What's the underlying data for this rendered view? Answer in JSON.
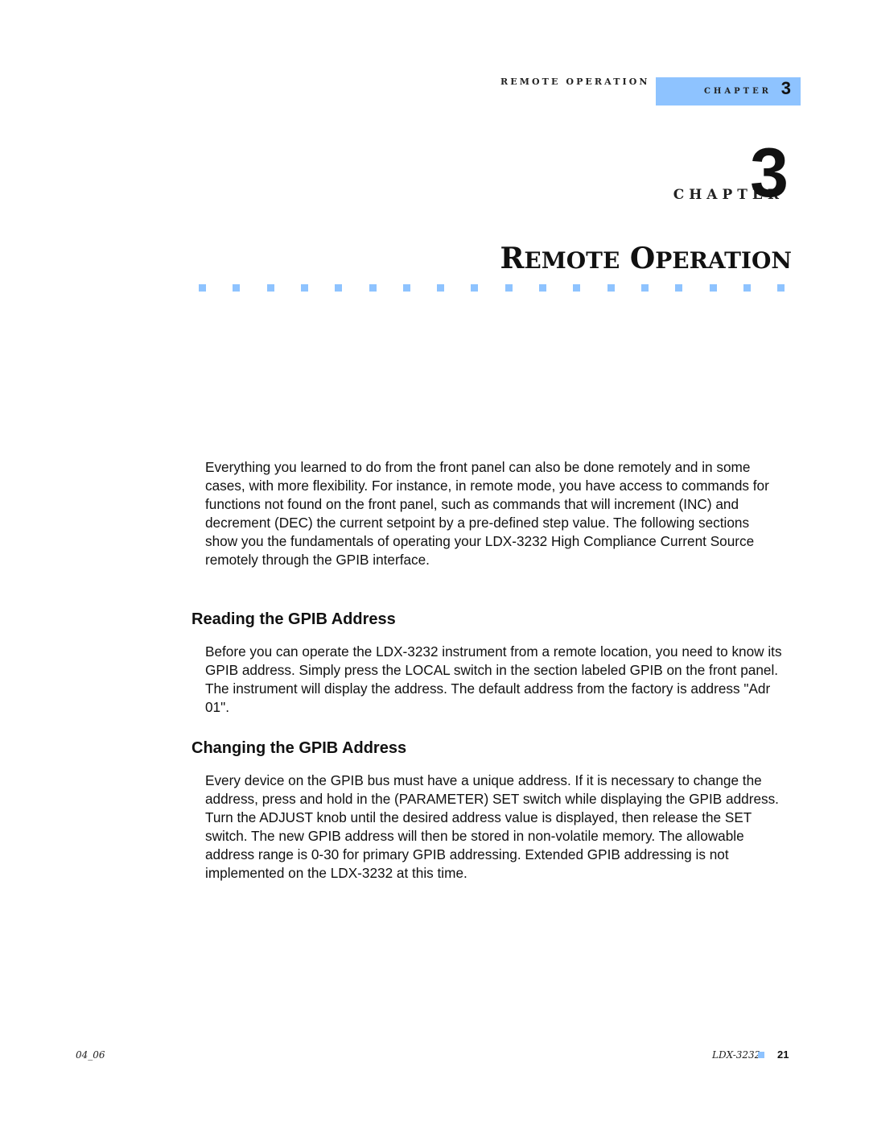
{
  "header": {
    "running_head": "REMOTE OPERATION",
    "chapter_tab_label": "CHAPTER",
    "chapter_tab_number": "3"
  },
  "chapter_heading": {
    "label": "CHAPTER",
    "number": "3",
    "title_part1_initial": "R",
    "title_part1_rest": "EMOTE",
    "title_part2_initial": "O",
    "title_part2_rest": "PERATION",
    "decoration_square_count": 18,
    "accent_color": "#8ec3ff"
  },
  "body": {
    "intro": "Everything you learned to do from the front panel can also be done remotely and in some cases, with more flexibility. For instance, in remote mode, you have access to commands for functions not found on the front panel, such as commands that will increment (INC) and decrement (DEC) the current setpoint by a pre-defined step value. The following sections show you the fundamentals of operating your LDX-3232 High Compliance Current Source remotely through the GPIB interface.",
    "sections": [
      {
        "heading": "Reading the GPIB Address",
        "text": "Before you can operate the LDX-3232 instrument from a remote location, you need to know its GPIB address. Simply press the LOCAL switch in the section labeled GPIB on the front panel. The instrument will display the address. The default address from the factory is address \"Adr 01\"."
      },
      {
        "heading": "Changing the GPIB Address",
        "text": "Every device on the GPIB bus must have a unique address. If it is necessary to change the address, press and hold in the (PARAMETER) SET switch while displaying the GPIB address. Turn the ADJUST knob until the desired address value is displayed, then release the SET switch. The new GPIB address will then be stored in non-volatile memory. The allowable address range is 0-30 for primary GPIB addressing. Extended GPIB addressing is not implemented on the LDX-3232 at this time."
      }
    ]
  },
  "footer": {
    "left": "04_06",
    "product": "LDX-3232",
    "page_number": "21"
  }
}
